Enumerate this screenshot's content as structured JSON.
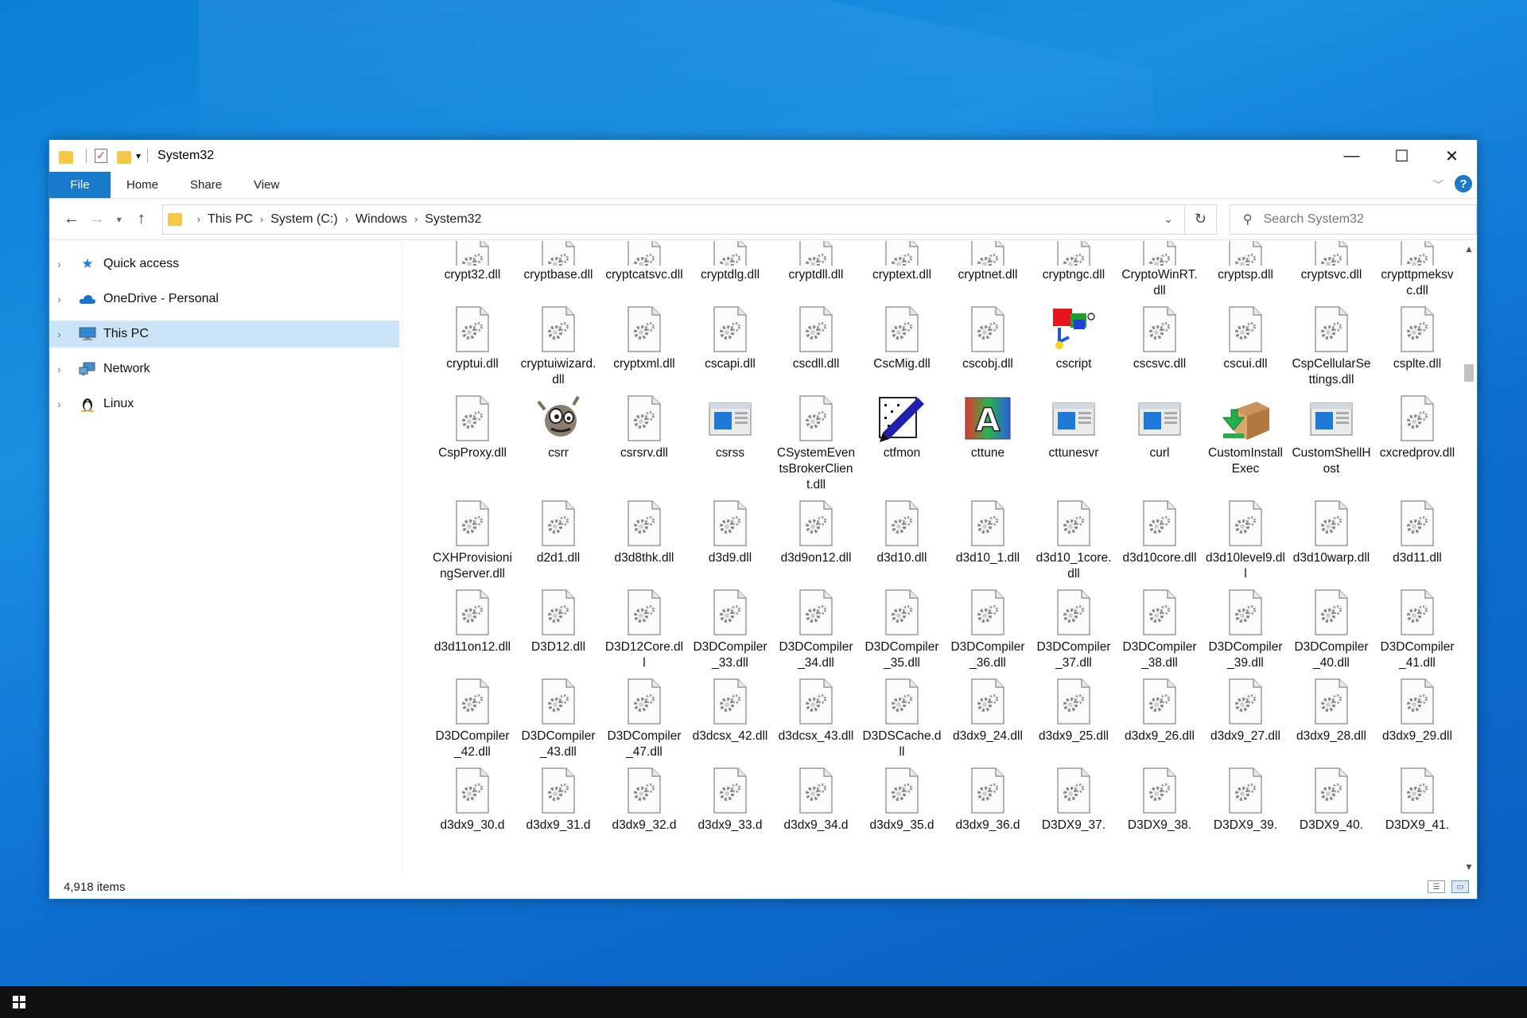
{
  "window": {
    "title": "System32",
    "tabs": [
      "File",
      "Home",
      "Share",
      "View"
    ]
  },
  "address": {
    "crumbs": [
      "This PC",
      "System (C:)",
      "Windows",
      "System32"
    ],
    "search_placeholder": "Search System32"
  },
  "nav": {
    "items": [
      {
        "label": "Quick access",
        "icon": "star-icon"
      },
      {
        "label": "OneDrive - Personal",
        "icon": "cloud-icon"
      },
      {
        "label": "This PC",
        "icon": "computer-icon"
      },
      {
        "label": "Network",
        "icon": "network-icon"
      },
      {
        "label": "Linux",
        "icon": "penguin-icon"
      }
    ],
    "selected": "This PC"
  },
  "files": {
    "rows": [
      [
        "crypt32.dll",
        "cryptbase.dll",
        "cryptcatsvc.dll",
        "cryptdlg.dll",
        "cryptdll.dll",
        "cryptext.dll",
        "cryptnet.dll",
        "cryptngc.dll",
        "CryptoWinRT.dll",
        "cryptsp.dll",
        "cryptsvc.dll",
        "crypttpmeksvc.dll"
      ],
      [
        "cryptui.dll",
        "cryptuiwizard.dll",
        "cryptxml.dll",
        "cscapi.dll",
        "cscdll.dll",
        "CscMig.dll",
        "cscobj.dll",
        "cscript",
        "cscsvc.dll",
        "cscui.dll",
        "CspCellularSettings.dll",
        "csplte.dll"
      ],
      [
        "CspProxy.dll",
        "csrr",
        "csrsrv.dll",
        "csrss",
        "CSystemEventsBrokerClient.dll",
        "ctfmon",
        "cttune",
        "cttunesvr",
        "curl",
        "CustomInstallExec",
        "CustomShellHost",
        "cxcredprov.dll"
      ],
      [
        "CXHProvisioningServer.dll",
        "d2d1.dll",
        "d3d8thk.dll",
        "d3d9.dll",
        "d3d9on12.dll",
        "d3d10.dll",
        "d3d10_1.dll",
        "d3d10_1core.dll",
        "d3d10core.dll",
        "d3d10level9.dll",
        "d3d10warp.dll",
        "d3d11.dll"
      ],
      [
        "d3d11on12.dll",
        "D3D12.dll",
        "D3D12Core.dll",
        "D3DCompiler_33.dll",
        "D3DCompiler_34.dll",
        "D3DCompiler_35.dll",
        "D3DCompiler_36.dll",
        "D3DCompiler_37.dll",
        "D3DCompiler_38.dll",
        "D3DCompiler_39.dll",
        "D3DCompiler_40.dll",
        "D3DCompiler_41.dll"
      ],
      [
        "D3DCompiler_42.dll",
        "D3DCompiler_43.dll",
        "D3DCompiler_47.dll",
        "d3dcsx_42.dll",
        "d3dcsx_43.dll",
        "D3DSCache.dll",
        "d3dx9_24.dll",
        "d3dx9_25.dll",
        "d3dx9_26.dll",
        "d3dx9_27.dll",
        "d3dx9_28.dll",
        "d3dx9_29.dll"
      ],
      [
        "d3dx9_30.d",
        "d3dx9_31.d",
        "d3dx9_32.d",
        "d3dx9_33.d",
        "d3dx9_34.d",
        "d3dx9_35.d",
        "d3dx9_36.d",
        "D3DX9_37.",
        "D3DX9_38.",
        "D3DX9_39.",
        "D3DX9_40.",
        "D3DX9_41."
      ]
    ],
    "special_icons": {
      "cscript": "script-icon",
      "csrr": "gimp-icon",
      "csrss": "window-app-icon",
      "ctfmon": "pen-icon",
      "cttune": "font-a-icon",
      "cttunesvr": "window-app-icon",
      "curl": "window-app-icon",
      "CustomInstallExec": "installer-box-icon",
      "CustomShellHost": "window-app-icon"
    }
  },
  "status": {
    "item_count": "4,918 items"
  }
}
